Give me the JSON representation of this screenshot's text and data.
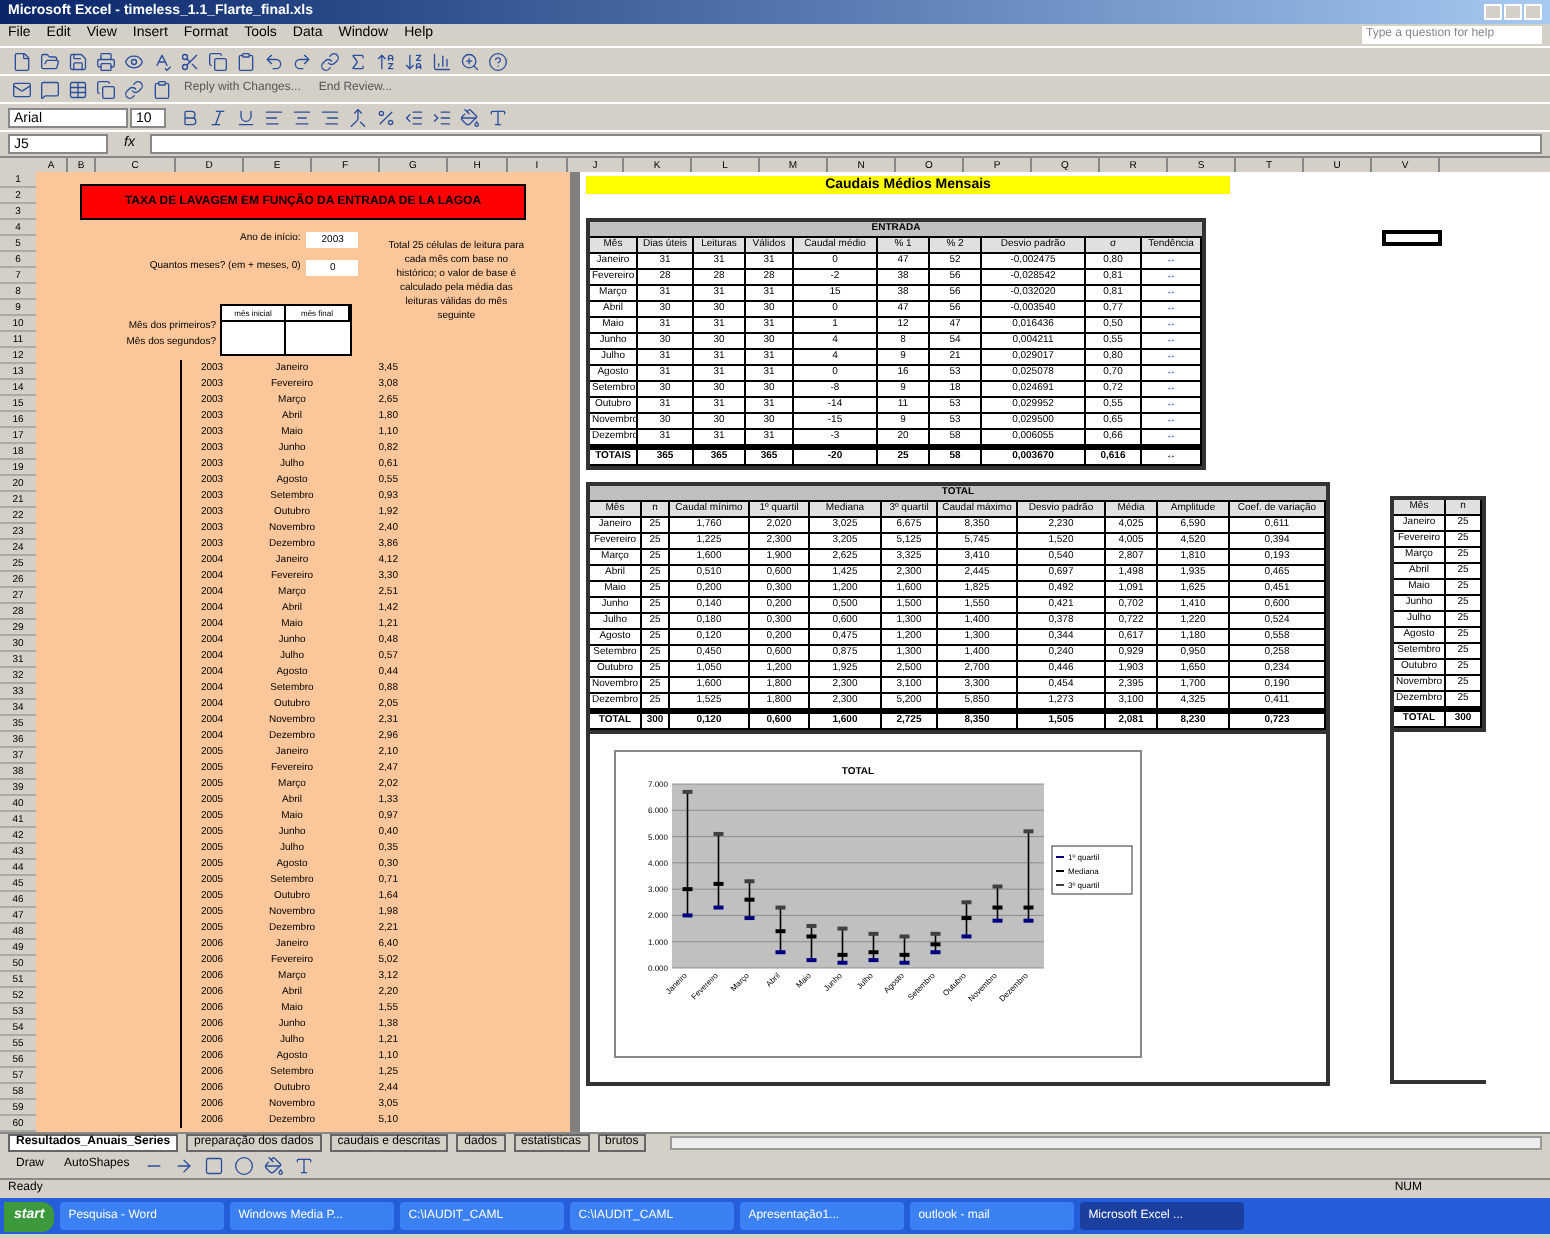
{
  "window": {
    "title": "Microsoft Excel - timeless_1.1_Flarte_final.xls"
  },
  "menu": [
    "File",
    "Edit",
    "View",
    "Insert",
    "Format",
    "Tools",
    "Data",
    "Window",
    "Help"
  ],
  "help_box": {
    "placeholder": "Type a question for help"
  },
  "review_toolbar": [
    "Reply with Changes...",
    "End Review..."
  ],
  "format_toolbar": {
    "font": "Arial",
    "size": "10"
  },
  "formula_bar": {
    "name_box": "J5",
    "fx": "fx"
  },
  "columns": [
    "A",
    "B",
    "C",
    "D",
    "E",
    "F",
    "G",
    "H",
    "I",
    "J",
    "K",
    "L",
    "M",
    "N",
    "O",
    "P",
    "Q",
    "R",
    "S",
    "T",
    "U",
    "V"
  ],
  "row_numbers": [
    "1",
    "2",
    "3",
    "4",
    "5",
    "6",
    "7",
    "8",
    "9",
    "10",
    "11",
    "12",
    "13",
    "14",
    "15",
    "16",
    "17",
    "18",
    "19",
    "20",
    "21",
    "22",
    "23",
    "24",
    "25",
    "26",
    "27",
    "28",
    "29",
    "30",
    "31",
    "32",
    "33",
    "34",
    "35",
    "36",
    "37",
    "38",
    "39",
    "40",
    "41",
    "42",
    "43",
    "44",
    "45",
    "46",
    "47",
    "48",
    "49",
    "50",
    "51",
    "52",
    "53",
    "54",
    "55",
    "56",
    "57",
    "58",
    "59",
    "60"
  ],
  "left_panel": {
    "header": "TAXA DE LAVAGEM EM FUNÇÃO DA ENTRADA DE LA LAGOA",
    "fields": [
      {
        "label": "Ano de início:",
        "value": "2003"
      },
      {
        "label": "Quantos meses? (em + meses, 0)",
        "value": "0"
      }
    ],
    "period_table": {
      "columns": [
        "mês inicial",
        "mês final"
      ],
      "rows": [
        "Mês dos primeiros?",
        "Mês dos segundos?"
      ]
    },
    "note": "Total 25 células de leitura para cada mês com base no histórico; o valor de base é calculado pela média das leituras válidas do mês seguinte",
    "list": [
      [
        "2003",
        "Janeiro",
        "3,45"
      ],
      [
        "2003",
        "Fevereiro",
        "3,08"
      ],
      [
        "2003",
        "Março",
        "2,65"
      ],
      [
        "2003",
        "Abril",
        "1,80"
      ],
      [
        "2003",
        "Maio",
        "1,10"
      ],
      [
        "2003",
        "Junho",
        "0,82"
      ],
      [
        "2003",
        "Julho",
        "0,61"
      ],
      [
        "2003",
        "Agosto",
        "0,55"
      ],
      [
        "2003",
        "Setembro",
        "0,93"
      ],
      [
        "2003",
        "Outubro",
        "1,92"
      ],
      [
        "2003",
        "Novembro",
        "2,40"
      ],
      [
        "2003",
        "Dezembro",
        "3,86"
      ],
      [
        "2004",
        "Janeiro",
        "4,12"
      ],
      [
        "2004",
        "Fevereiro",
        "3,30"
      ],
      [
        "2004",
        "Março",
        "2,51"
      ],
      [
        "2004",
        "Abril",
        "1,42"
      ],
      [
        "2004",
        "Maio",
        "1,21"
      ],
      [
        "2004",
        "Junho",
        "0,48"
      ],
      [
        "2004",
        "Julho",
        "0,57"
      ],
      [
        "2004",
        "Agosto",
        "0,44"
      ],
      [
        "2004",
        "Setembro",
        "0,88"
      ],
      [
        "2004",
        "Outubro",
        "2,05"
      ],
      [
        "2004",
        "Novembro",
        "2,31"
      ],
      [
        "2004",
        "Dezembro",
        "2,96"
      ],
      [
        "2005",
        "Janeiro",
        "2,10"
      ],
      [
        "2005",
        "Fevereiro",
        "2,47"
      ],
      [
        "2005",
        "Março",
        "2,02"
      ],
      [
        "2005",
        "Abril",
        "1,33"
      ],
      [
        "2005",
        "Maio",
        "0,97"
      ],
      [
        "2005",
        "Junho",
        "0,40"
      ],
      [
        "2005",
        "Julho",
        "0,35"
      ],
      [
        "2005",
        "Agosto",
        "0,30"
      ],
      [
        "2005",
        "Setembro",
        "0,71"
      ],
      [
        "2005",
        "Outubro",
        "1,64"
      ],
      [
        "2005",
        "Novembro",
        "1,98"
      ],
      [
        "2005",
        "Dezembro",
        "2,21"
      ],
      [
        "2006",
        "Janeiro",
        "6,40"
      ],
      [
        "2006",
        "Fevereiro",
        "5,02"
      ],
      [
        "2006",
        "Março",
        "3,12"
      ],
      [
        "2006",
        "Abril",
        "2,20"
      ],
      [
        "2006",
        "Maio",
        "1,55"
      ],
      [
        "2006",
        "Junho",
        "1,38"
      ],
      [
        "2006",
        "Julho",
        "1,21"
      ],
      [
        "2006",
        "Agosto",
        "1,10"
      ],
      [
        "2006",
        "Setembro",
        "1,25"
      ],
      [
        "2006",
        "Outubro",
        "2,44"
      ],
      [
        "2006",
        "Novembro",
        "3,05"
      ],
      [
        "2006",
        "Dezembro",
        "5,10"
      ]
    ]
  },
  "title_bar": "Caudais Médios Mensais",
  "table_1": {
    "title": "ENTRADA",
    "columns": [
      "Mês",
      "Dias úteis",
      "Leituras",
      "Válidos",
      "Caudal médio",
      "% 1",
      "% 2",
      "Desvio padrão",
      "σ",
      "Tendência"
    ],
    "rows": [
      [
        "Janeiro",
        "31",
        "31",
        "31",
        "0",
        "47",
        "52",
        "-0,002475",
        "0,80",
        "↔"
      ],
      [
        "Fevereiro",
        "28",
        "28",
        "28",
        "-2",
        "38",
        "56",
        "-0,028542",
        "0,81",
        "↔"
      ],
      [
        "Março",
        "31",
        "31",
        "31",
        "15",
        "38",
        "56",
        "-0,032020",
        "0,81",
        "↔"
      ],
      [
        "Abril",
        "30",
        "30",
        "30",
        "0",
        "47",
        "56",
        "-0,003540",
        "0,77",
        "↔"
      ],
      [
        "Maio",
        "31",
        "31",
        "31",
        "1",
        "12",
        "47",
        "0,016436",
        "0,50",
        "↔"
      ],
      [
        "Junho",
        "30",
        "30",
        "30",
        "4",
        "8",
        "54",
        "0,004211",
        "0,55",
        "↔"
      ],
      [
        "Julho",
        "31",
        "31",
        "31",
        "4",
        "9",
        "21",
        "0,029017",
        "0,80",
        "↔"
      ],
      [
        "Agosto",
        "31",
        "31",
        "31",
        "0",
        "16",
        "53",
        "0,025078",
        "0,70",
        "↔"
      ],
      [
        "Setembro",
        "30",
        "30",
        "30",
        "-8",
        "9",
        "18",
        "0,024691",
        "0,72",
        "↔"
      ],
      [
        "Outubro",
        "31",
        "31",
        "31",
        "-14",
        "11",
        "53",
        "0,029952",
        "0,55",
        "↔"
      ],
      [
        "Novembro",
        "30",
        "30",
        "30",
        "-15",
        "9",
        "53",
        "0,029500",
        "0,65",
        "↔"
      ],
      [
        "Dezembro",
        "31",
        "31",
        "31",
        "-3",
        "20",
        "58",
        "0,006055",
        "0,66",
        "↔"
      ]
    ],
    "total": [
      "TOTAIS",
      "365",
      "365",
      "365",
      "-20",
      "25",
      "58",
      "0,003670",
      "0,616",
      "↔"
    ]
  },
  "table_2": {
    "title": "TOTAL",
    "columns": [
      "Mês",
      "n",
      "Caudal mínimo",
      "1º quartil",
      "Mediana",
      "3º quartil",
      "Caudal máximo",
      "Desvio padrão",
      "Média",
      "Amplitude",
      "Coef. de variação"
    ],
    "rows": [
      [
        "Janeiro",
        "25",
        "1,760",
        "2,020",
        "3,025",
        "6,675",
        "8,350",
        "2,230",
        "4,025",
        "6,590",
        "0,611"
      ],
      [
        "Fevereiro",
        "25",
        "1,225",
        "2,300",
        "3,205",
        "5,125",
        "5,745",
        "1,520",
        "4,005",
        "4,520",
        "0,394"
      ],
      [
        "Março",
        "25",
        "1,600",
        "1,900",
        "2,625",
        "3,325",
        "3,410",
        "0,540",
        "2,807",
        "1,810",
        "0,193"
      ],
      [
        "Abril",
        "25",
        "0,510",
        "0,600",
        "1,425",
        "2,300",
        "2,445",
        "0,697",
        "1,498",
        "1,935",
        "0,465"
      ],
      [
        "Maio",
        "25",
        "0,200",
        "0,300",
        "1,200",
        "1,600",
        "1,825",
        "0,492",
        "1,091",
        "1,625",
        "0,451"
      ],
      [
        "Junho",
        "25",
        "0,140",
        "0,200",
        "0,500",
        "1,500",
        "1,550",
        "0,421",
        "0,702",
        "1,410",
        "0,600"
      ],
      [
        "Julho",
        "25",
        "0,180",
        "0,300",
        "0,600",
        "1,300",
        "1,400",
        "0,378",
        "0,722",
        "1,220",
        "0,524"
      ],
      [
        "Agosto",
        "25",
        "0,120",
        "0,200",
        "0,475",
        "1,200",
        "1,300",
        "0,344",
        "0,617",
        "1,180",
        "0,558"
      ],
      [
        "Setembro",
        "25",
        "0,450",
        "0,600",
        "0,875",
        "1,300",
        "1,400",
        "0,240",
        "0,929",
        "0,950",
        "0,258"
      ],
      [
        "Outubro",
        "25",
        "1,050",
        "1,200",
        "1,925",
        "2,500",
        "2,700",
        "0,446",
        "1,903",
        "1,650",
        "0,234"
      ],
      [
        "Novembro",
        "25",
        "1,600",
        "1,800",
        "2,300",
        "3,100",
        "3,300",
        "0,454",
        "2,395",
        "1,700",
        "0,190"
      ],
      [
        "Dezembro",
        "25",
        "1,525",
        "1,800",
        "2,300",
        "5,200",
        "5,850",
        "1,273",
        "3,100",
        "4,325",
        "0,411"
      ]
    ],
    "total": [
      "TOTAL",
      "300",
      "0,120",
      "0,600",
      "1,600",
      "2,725",
      "8,350",
      "1,505",
      "2,081",
      "8,230",
      "0,723"
    ]
  },
  "table_3": {
    "columns": [
      "Mês",
      "n"
    ],
    "rows": [
      [
        "Janeiro",
        "25"
      ],
      [
        "Fevereiro",
        "25"
      ],
      [
        "Março",
        "25"
      ],
      [
        "Abril",
        "25"
      ],
      [
        "Maio",
        "25"
      ],
      [
        "Junho",
        "25"
      ],
      [
        "Julho",
        "25"
      ],
      [
        "Agosto",
        "25"
      ],
      [
        "Setembro",
        "25"
      ],
      [
        "Outubro",
        "25"
      ],
      [
        "Novembro",
        "25"
      ],
      [
        "Dezembro",
        "25"
      ]
    ],
    "total": [
      "TOTAL",
      "300"
    ]
  },
  "chart_data": {
    "type": "scatter",
    "title": "TOTAL",
    "categories": [
      "Janeiro",
      "Fevereiro",
      "Março",
      "Abril",
      "Maio",
      "Junho",
      "Julho",
      "Agosto",
      "Setembro",
      "Outubro",
      "Novembro",
      "Dezembro"
    ],
    "ylim": [
      0,
      7000
    ],
    "grid": true,
    "legend": "right",
    "yticks": [
      {
        "value": 0,
        "label": "0.000"
      },
      {
        "value": 1000,
        "label": "1.000"
      },
      {
        "value": 2000,
        "label": "2.000"
      },
      {
        "value": 3000,
        "label": "3.000"
      },
      {
        "value": 4000,
        "label": "4.000"
      },
      {
        "value": 5000,
        "label": "5.000"
      },
      {
        "value": 6000,
        "label": "6.000"
      },
      {
        "value": 7000,
        "label": "7.000"
      }
    ],
    "series": [
      {
        "name": "1º quartil",
        "color": "#000080",
        "values": [
          2000,
          2300,
          1900,
          600,
          300,
          200,
          300,
          200,
          600,
          1200,
          1800,
          1800
        ]
      },
      {
        "name": "Mediana",
        "color": "#000000",
        "values": [
          3000,
          3200,
          2600,
          1400,
          1200,
          500,
          600,
          500,
          900,
          1900,
          2300,
          2300
        ]
      },
      {
        "name": "3º quartil",
        "color": "#404040",
        "values": [
          6700,
          5100,
          3300,
          2300,
          1600,
          1500,
          1300,
          1200,
          1300,
          2500,
          3100,
          5200
        ]
      }
    ]
  },
  "sheet_tabs": [
    {
      "label": "Resultados_Anuais_Series",
      "selected": true
    },
    {
      "label": "preparação dos dados",
      "selected": false
    },
    {
      "label": "caudais e descritas",
      "selected": false
    },
    {
      "label": "dados",
      "selected": false
    },
    {
      "label": "estatísticas",
      "selected": false
    },
    {
      "label": "brutos",
      "selected": false
    }
  ],
  "draw_toolbar": [
    "Draw",
    "AutoShapes"
  ],
  "status_bar": {
    "left": "Ready",
    "right": "NUM"
  },
  "taskbar": {
    "start": "start",
    "items": [
      {
        "label": "Pesquisa - Word",
        "selected": false
      },
      {
        "label": "Windows Media P...",
        "selected": false
      },
      {
        "label": "C:\\IAUDIT_CAML",
        "selected": false
      },
      {
        "label": "C:\\IAUDIT_CAML",
        "selected": false
      },
      {
        "label": "Apresentação1...",
        "selected": false
      },
      {
        "label": "outlook - mail",
        "selected": false
      },
      {
        "label": "Microsoft Excel ...",
        "selected": true
      }
    ]
  }
}
